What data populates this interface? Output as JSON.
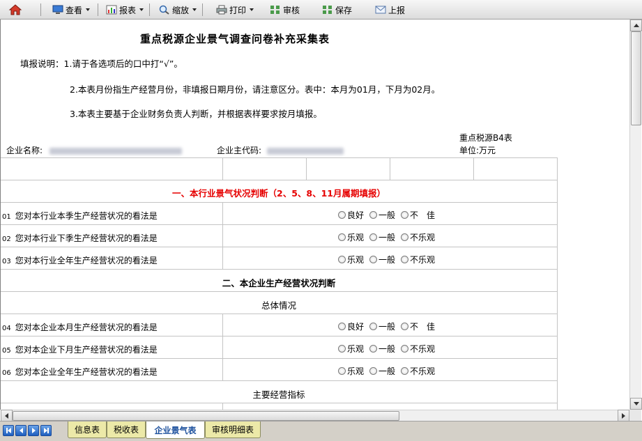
{
  "toolbar": {
    "view": "查看",
    "report": "报表",
    "zoom": "缩放",
    "print": "打印",
    "audit": "审核",
    "save": "保存",
    "submit": "上报"
  },
  "form": {
    "title": "重点税源企业景气调查问卷补充采集表",
    "instructions": [
      "填报说明：1.请于各选项后的口中打“√”。",
      "2.本表月份指生产经营月份，非填报日期月份，请注意区分。表中：本月为01月，下月为02月。",
      "3.本表主要基于企业财务负责人判断，并根据表样要求按月填报。"
    ],
    "company_name_label": "企业名称:",
    "company_code_label": "企业主代码:",
    "form_code": "重点税源B4表",
    "unit": "单位:万元"
  },
  "sections": {
    "s1": "一、本行业景气状况判断（2、5、8、11月属期填报）",
    "s2": "二、本企业生产经营状况判断",
    "s2a": "总体情况",
    "s2b": "主要经营指标"
  },
  "questions": [
    {
      "num": "01",
      "text": "您对本行业本季生产经营状况的看法是",
      "options": [
        "良好",
        "一般",
        "不　佳"
      ]
    },
    {
      "num": "02",
      "text": "您对本行业下季生产经营状况的看法是",
      "options": [
        "乐观",
        "一般",
        "不乐观"
      ]
    },
    {
      "num": "03",
      "text": "您对本行业全年生产经营状况的看法是",
      "options": [
        "乐观",
        "一般",
        "不乐观"
      ]
    },
    {
      "num": "04",
      "text": "您对本企业本月生产经营状况的看法是",
      "options": [
        "良好",
        "一般",
        "不　佳"
      ]
    },
    {
      "num": "05",
      "text": "您对本企业下月生产经营状况的看法是",
      "options": [
        "乐观",
        "一般",
        "不乐观"
      ]
    },
    {
      "num": "06",
      "text": "您对本企业全年生产经营状况的看法是",
      "options": [
        "乐观",
        "一般",
        "不乐观"
      ]
    }
  ],
  "tabs": [
    "信息表",
    "税收表",
    "企业景气表",
    "审核明细表"
  ],
  "colors": {
    "section_red": "#e60000",
    "active_tab": "#1b4f9c",
    "tab_bg": "#ece9a8"
  }
}
